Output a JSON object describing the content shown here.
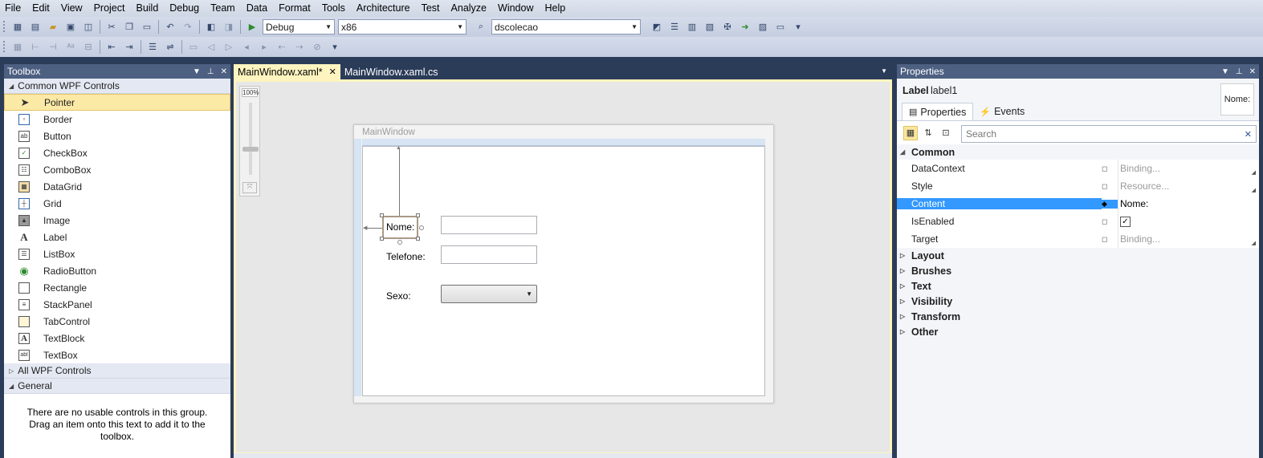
{
  "menu": [
    "File",
    "Edit",
    "View",
    "Project",
    "Build",
    "Debug",
    "Team",
    "Data",
    "Format",
    "Tools",
    "Architecture",
    "Test",
    "Analyze",
    "Window",
    "Help"
  ],
  "toolbar": {
    "configuration": "Debug",
    "platform": "x86",
    "startup_project": "dscolecao"
  },
  "toolbox": {
    "title": "Toolbox",
    "group_common": "Common WPF Controls",
    "items": [
      {
        "label": "Pointer",
        "icon": "pointer-icon"
      },
      {
        "label": "Border",
        "icon": "border-icon"
      },
      {
        "label": "Button",
        "icon": "button-icon"
      },
      {
        "label": "CheckBox",
        "icon": "checkbox-icon"
      },
      {
        "label": "ComboBox",
        "icon": "combobox-icon"
      },
      {
        "label": "DataGrid",
        "icon": "datagrid-icon"
      },
      {
        "label": "Grid",
        "icon": "grid-icon"
      },
      {
        "label": "Image",
        "icon": "image-icon"
      },
      {
        "label": "Label",
        "icon": "label-icon"
      },
      {
        "label": "ListBox",
        "icon": "listbox-icon"
      },
      {
        "label": "RadioButton",
        "icon": "radiobutton-icon"
      },
      {
        "label": "Rectangle",
        "icon": "rectangle-icon"
      },
      {
        "label": "StackPanel",
        "icon": "stackpanel-icon"
      },
      {
        "label": "TabControl",
        "icon": "tabcontrol-icon"
      },
      {
        "label": "TextBlock",
        "icon": "textblock-icon"
      },
      {
        "label": "TextBox",
        "icon": "textbox-icon"
      }
    ],
    "group_all": "All WPF Controls",
    "group_general": "General",
    "empty_message": "There are no usable controls in this group. Drag an item onto this text to add it to the toolbox."
  },
  "document": {
    "tabs": [
      "MainWindow.xaml*",
      "MainWindow.xaml.cs"
    ],
    "zoom": "100%",
    "window_title": "MainWindow",
    "form": {
      "nome_label": "Nome:",
      "telefone_label": "Telefone:",
      "sexo_label": "Sexo:"
    }
  },
  "properties": {
    "title": "Properties",
    "type": "Label",
    "name": "label1",
    "preview": "Nome:",
    "tab_properties": "Properties",
    "tab_events": "Events",
    "search_placeholder": "Search",
    "category_common": "Common",
    "rows": [
      {
        "name": "DataContext",
        "value": "Binding..."
      },
      {
        "name": "Style",
        "value": "Resource..."
      },
      {
        "name": "Content",
        "value": "Nome:"
      },
      {
        "name": "IsEnabled",
        "value": "✓"
      },
      {
        "name": "Target",
        "value": "Binding..."
      }
    ],
    "categories": [
      "Layout",
      "Brushes",
      "Text",
      "Visibility",
      "Transform",
      "Other"
    ]
  },
  "colors": {
    "chrome_dark": "#2b3c59",
    "title_bar": "#4d6082",
    "selection": "#3399ff",
    "active_doc": "#fdf4bf"
  }
}
